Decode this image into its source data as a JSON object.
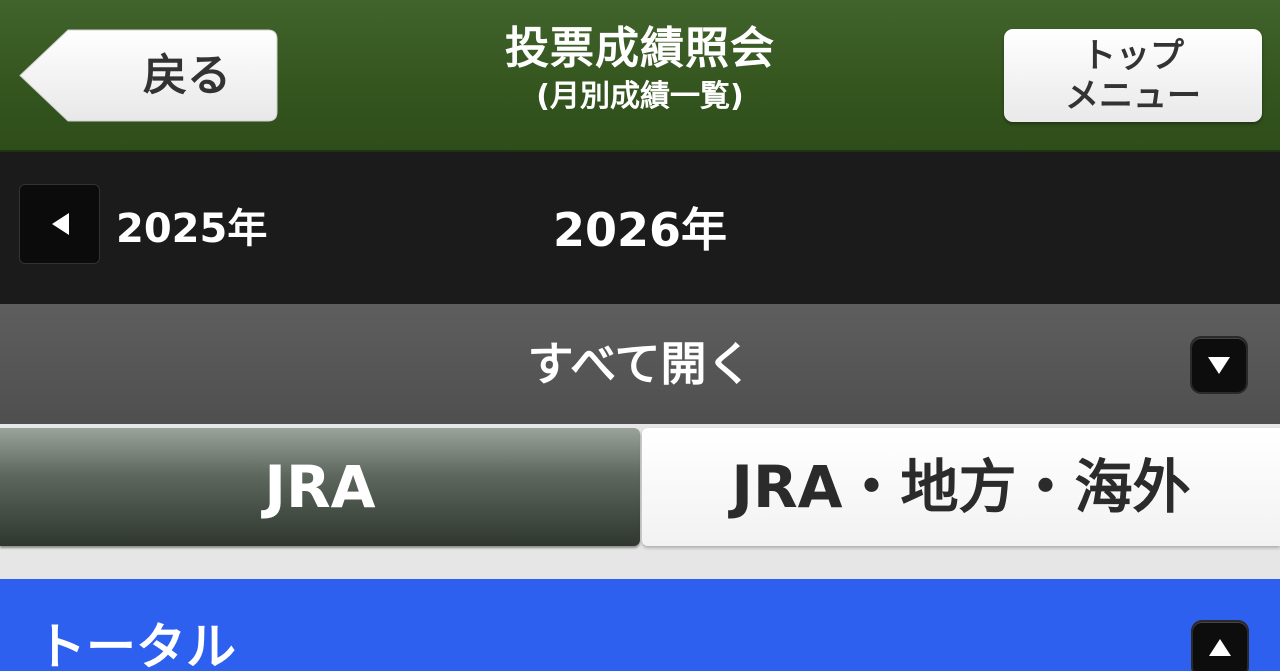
{
  "header": {
    "back_label": "戻る",
    "title": "投票成績照会",
    "subtitle": "(月別成績一覧)",
    "top_menu_line1": "トップ",
    "top_menu_line2": "メニュー"
  },
  "year_nav": {
    "prev_year_label": "2025年",
    "current_year": "2026年"
  },
  "expand_all": {
    "label": "すべて開く"
  },
  "tabs": [
    {
      "label": "JRA",
      "selected": true
    },
    {
      "label": "JRA・地方・海外",
      "selected": false
    }
  ],
  "sections": [
    {
      "label": "トータル",
      "expanded": true
    }
  ],
  "colors": {
    "header_green": "#35561f",
    "year_bar": "#1b1b1b",
    "expand_bar": "#575757",
    "section_blue": "#2e60f0",
    "selected_tab": "#3a433a"
  },
  "icons": {
    "prev_year": "triangle-left-icon",
    "expand_all": "triangle-down-icon",
    "section_toggle": "triangle-up-icon"
  }
}
